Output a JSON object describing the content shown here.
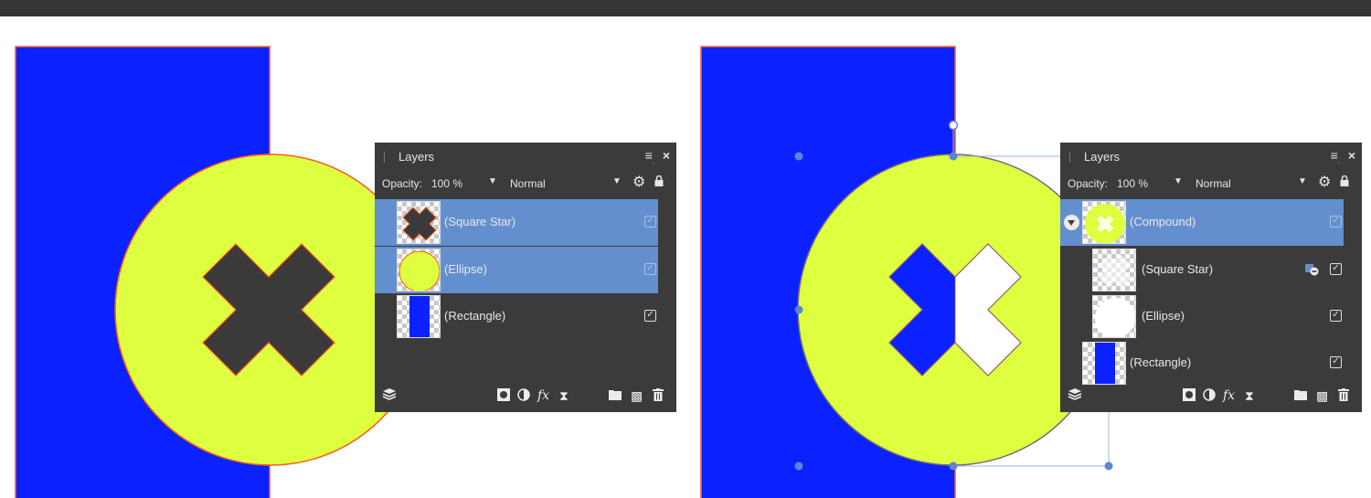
{
  "canvas": {
    "colors": {
      "background": "#ffffff",
      "rectangle_blue": "#0b21ff",
      "ellipse_yellow": "#ddff3f",
      "star_dark": "#3a3a3a",
      "outline_orange": "#ff5a1e",
      "selection_handle": "#5b86d0"
    }
  },
  "panels": [
    {
      "title": "Layers",
      "opacity_label": "Opacity:",
      "opacity_value": "100 %",
      "blend_mode": "Normal",
      "icons": [
        "panel-menu-icon",
        "close-icon",
        "gear-icon",
        "lock-icon"
      ],
      "layers": [
        {
          "label": "(Square Star)",
          "selected": true,
          "visible": true,
          "thumb": "square-star"
        },
        {
          "label": "(Ellipse)",
          "selected": true,
          "visible": true,
          "thumb": "ellipse"
        },
        {
          "label": "(Rectangle)",
          "selected": false,
          "visible": true,
          "thumb": "rectangle"
        }
      ],
      "footer_icons": [
        "layers-stack-icon",
        "mask-icon",
        "adjustment-icon",
        "fx-icon",
        "hourglass-icon",
        "folder-icon",
        "pixel-layer-icon",
        "trash-icon"
      ],
      "fx_label": "fx"
    },
    {
      "title": "Layers",
      "opacity_label": "Opacity:",
      "opacity_value": "100 %",
      "blend_mode": "Normal",
      "icons": [
        "panel-menu-icon",
        "close-icon",
        "gear-icon",
        "lock-icon"
      ],
      "layers": [
        {
          "label": "(Compound)",
          "selected": true,
          "visible": true,
          "thumb": "compound",
          "expandable": true
        },
        {
          "label": "(Square Star)",
          "selected": false,
          "visible": true,
          "thumb": "white-star",
          "child": true,
          "boolean_op": "subtract"
        },
        {
          "label": "(Ellipse)",
          "selected": false,
          "visible": true,
          "thumb": "white-ellipse",
          "child": true
        },
        {
          "label": "(Rectangle)",
          "selected": false,
          "visible": true,
          "thumb": "rectangle"
        }
      ],
      "footer_icons": [
        "layers-stack-icon",
        "mask-icon",
        "adjustment-icon",
        "fx-icon",
        "hourglass-icon",
        "folder-icon",
        "pixel-layer-icon",
        "trash-icon"
      ],
      "fx_label": "fx"
    }
  ]
}
